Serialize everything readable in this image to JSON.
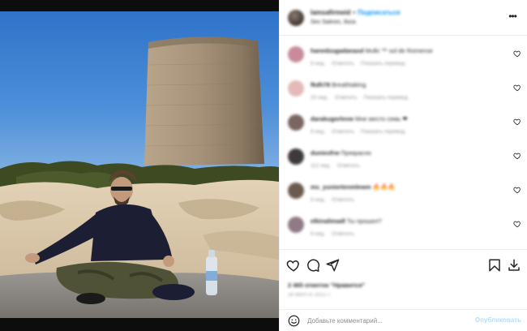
{
  "post": {
    "username": "lamsafirmeid",
    "follow_label": "Подписаться",
    "location": "Ses Salines, Ibiza"
  },
  "comments": [
    {
      "user": "hanedzugadanasd",
      "text": "Mulki ™ sol de Romense",
      "time": "6 нед.",
      "likes": "Ответить",
      "reply": "Показать перевод",
      "avatar_color": "#c98b9b"
    },
    {
      "user": "fkdh78",
      "text": "Breathtaking",
      "time": "20 нед.",
      "likes": "Ответить",
      "reply": "Показать перевод",
      "avatar_color": "#e5b9b9"
    },
    {
      "user": "darakugorlevw",
      "text": "Мне место семь ❤",
      "time": "6 нед.",
      "likes": "Ответить",
      "reply": "Показать перевод",
      "avatar_color": "#7a6560"
    },
    {
      "user": "duniesfrw",
      "text": "Прекрасно",
      "time": "112 нед.",
      "likes": "Ответить",
      "reply": "",
      "avatar_color": "#3e3a3a"
    },
    {
      "user": "ms_yuniortenmlewm",
      "text": "🔥🔥🔥",
      "time": "6 нед.",
      "likes": "Ответить",
      "reply": "",
      "avatar_color": "#6b5a4e"
    },
    {
      "user": "elkinalimadl",
      "text": "Ты прошел?",
      "time": "6 нед.",
      "likes": "Ответить",
      "reply": "",
      "avatar_color": "#8f7a86"
    }
  ],
  "actions": {
    "likes_text": "2 465 отметок \"Нравится\"",
    "date_text": "29 МАРТА 2021 Г."
  },
  "add_comment": {
    "placeholder": "Добавьте комментарий...",
    "publish_label": "Опубликовать"
  },
  "colors": {
    "accent": "#0095f6",
    "publish_disabled": "#b2dffc",
    "sky": "#3d7fd0"
  },
  "icons": [
    "more-icon",
    "heart-icon",
    "comment-icon",
    "share-icon",
    "bookmark-icon",
    "download-icon",
    "emoji-icon"
  ]
}
